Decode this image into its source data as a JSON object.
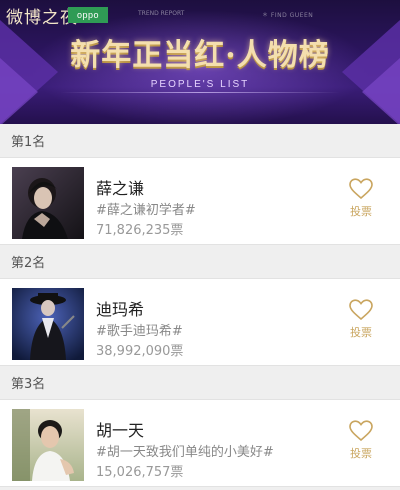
{
  "banner": {
    "logo_text": "微博之夜",
    "sponsor": "oppo",
    "small_left": "TREND REPORT",
    "small_right": "＊ FIND GUEEN",
    "title": "新年正当红·人物榜",
    "subtitle": "PEOPLE'S LIST"
  },
  "colors": {
    "accent_gold": "#c9a55f",
    "banner_purple": "#2c1560",
    "sponsor_green": "#2f9b55"
  },
  "entries": [
    {
      "rank": "第1名",
      "name": "薛之谦",
      "tag": "#薛之谦初学者#",
      "votes": "71,826,235票",
      "vote_label": "投票",
      "vote_icon": "heart-outline-icon"
    },
    {
      "rank": "第2名",
      "name": "迪玛希",
      "tag": "#歌手迪玛希#",
      "votes": "38,992,090票",
      "vote_label": "投票",
      "vote_icon": "heart-outline-icon"
    },
    {
      "rank": "第3名",
      "name": "胡一天",
      "tag": "#胡一天致我们单纯的小美好#",
      "votes": "15,026,757票",
      "vote_label": "投票",
      "vote_icon": "heart-outline-icon"
    }
  ]
}
